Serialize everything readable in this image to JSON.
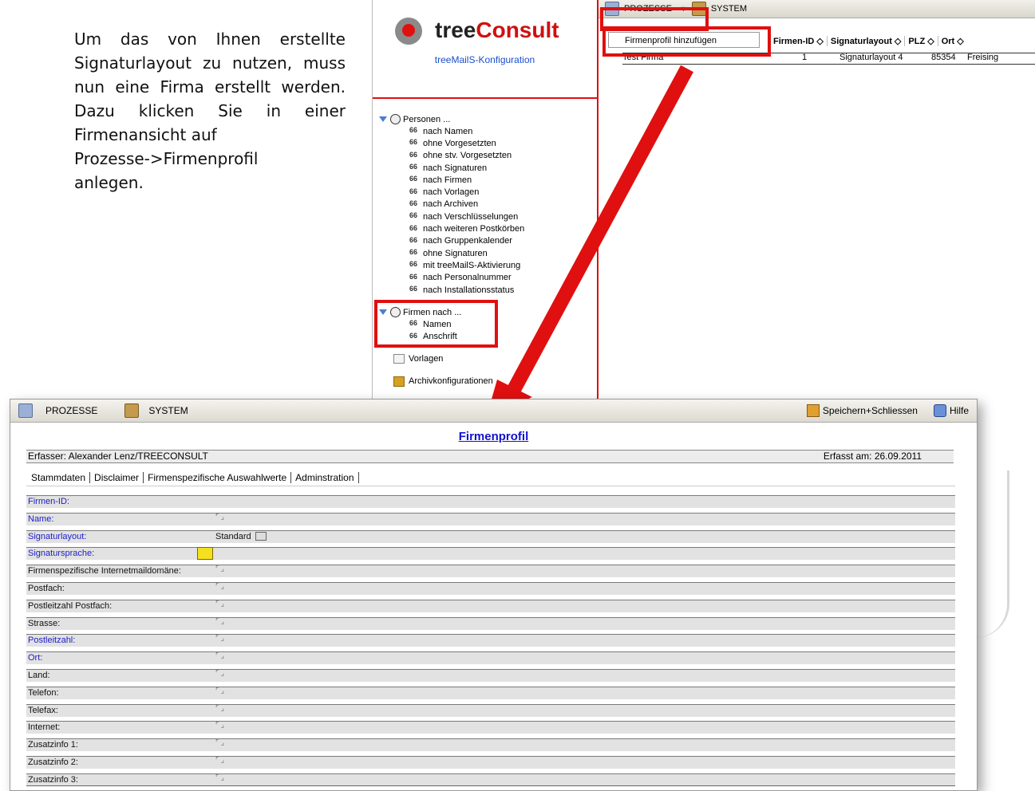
{
  "instruction": {
    "text_justified": "Um das von Ihnen erstellte Signaturlayout zu nutzen, muss nun eine Firma erstellt werden. Dazu klicken Sie in einer Firmenansicht auf",
    "line_proc": "Prozesse->Firmenprofil",
    "line_end": "anlegen."
  },
  "app": {
    "logo_tree": "tree",
    "logo_consult": "Consult",
    "subtitle": "treeMailS-Konfiguration",
    "personen_group": "Personen ...",
    "personen_items": [
      "nach Namen",
      "ohne Vorgesetzten",
      "ohne stv. Vorgesetzten",
      "nach Signaturen",
      "nach Firmen",
      "nach Vorlagen",
      "nach Archiven",
      "nach Verschlüsselungen",
      "nach weiteren Postkörben",
      "nach Gruppenkalender",
      "ohne Signaturen",
      "mit treeMailS-Aktivierung",
      "nach Personalnummer",
      "nach Installationsstatus"
    ],
    "firmen_group": "Firmen nach ...",
    "firmen_items": [
      "Namen",
      "Anschrift"
    ],
    "vorlagen": "Vorlagen",
    "archiv": "Archivkonfigurationen",
    "toolbar": {
      "prozesse": "PROZESSE",
      "system": "SYSTEM"
    },
    "menu_item": "Firmenprofil hinzufügen",
    "columns": [
      "Firmen-ID ◇",
      "Signaturlayout ◇",
      "PLZ ◇",
      "Ort ◇"
    ],
    "row": {
      "name": "Test Firma",
      "id": "1",
      "layout": "Signaturlayout 4",
      "plz": "85354",
      "ort": "Freising"
    }
  },
  "form": {
    "toolbar": {
      "prozesse": "PROZESSE",
      "system": "SYSTEM",
      "save": "Speichern+Schliessen",
      "help": "Hilfe"
    },
    "title": "Firmenprofil",
    "erfasser": "Erfasser: Alexander Lenz/TREECONSULT",
    "erfasst": "Erfasst am: 26.09.2011",
    "tabs": [
      "Stammdaten",
      "Disclaimer",
      "Firmenspezifische Auswahlwerte",
      "Adminstration"
    ],
    "fields": [
      {
        "label": "Firmen-ID:",
        "blue": true
      },
      {
        "label": "Name:",
        "blue": true
      },
      {
        "label": "Signaturlayout:",
        "blue": true
      },
      {
        "label": "Signatursprache:",
        "blue": true
      },
      {
        "label": "Firmenspezifische Internetmaildomäne:",
        "blue": false
      },
      {
        "label": "Postfach:",
        "blue": false
      },
      {
        "label": "Postleitzahl Postfach:",
        "blue": false
      },
      {
        "label": "Strasse:",
        "blue": false
      },
      {
        "label": "Postleitzahl:",
        "blue": true
      },
      {
        "label": "Ort:",
        "blue": true
      },
      {
        "label": "Land:",
        "blue": false
      },
      {
        "label": "Telefon:",
        "blue": false
      },
      {
        "label": "Telefax:",
        "blue": false
      },
      {
        "label": "Internet:",
        "blue": false
      },
      {
        "label": "Zusatzinfo 1:",
        "blue": false
      },
      {
        "label": "Zusatzinfo 2:",
        "blue": false
      },
      {
        "label": "Zusatzinfo 3:",
        "blue": false
      }
    ],
    "signaturlayout_value": "Standard"
  },
  "colors": {
    "highlight": "#e01010",
    "link_blue": "#1212cc"
  }
}
